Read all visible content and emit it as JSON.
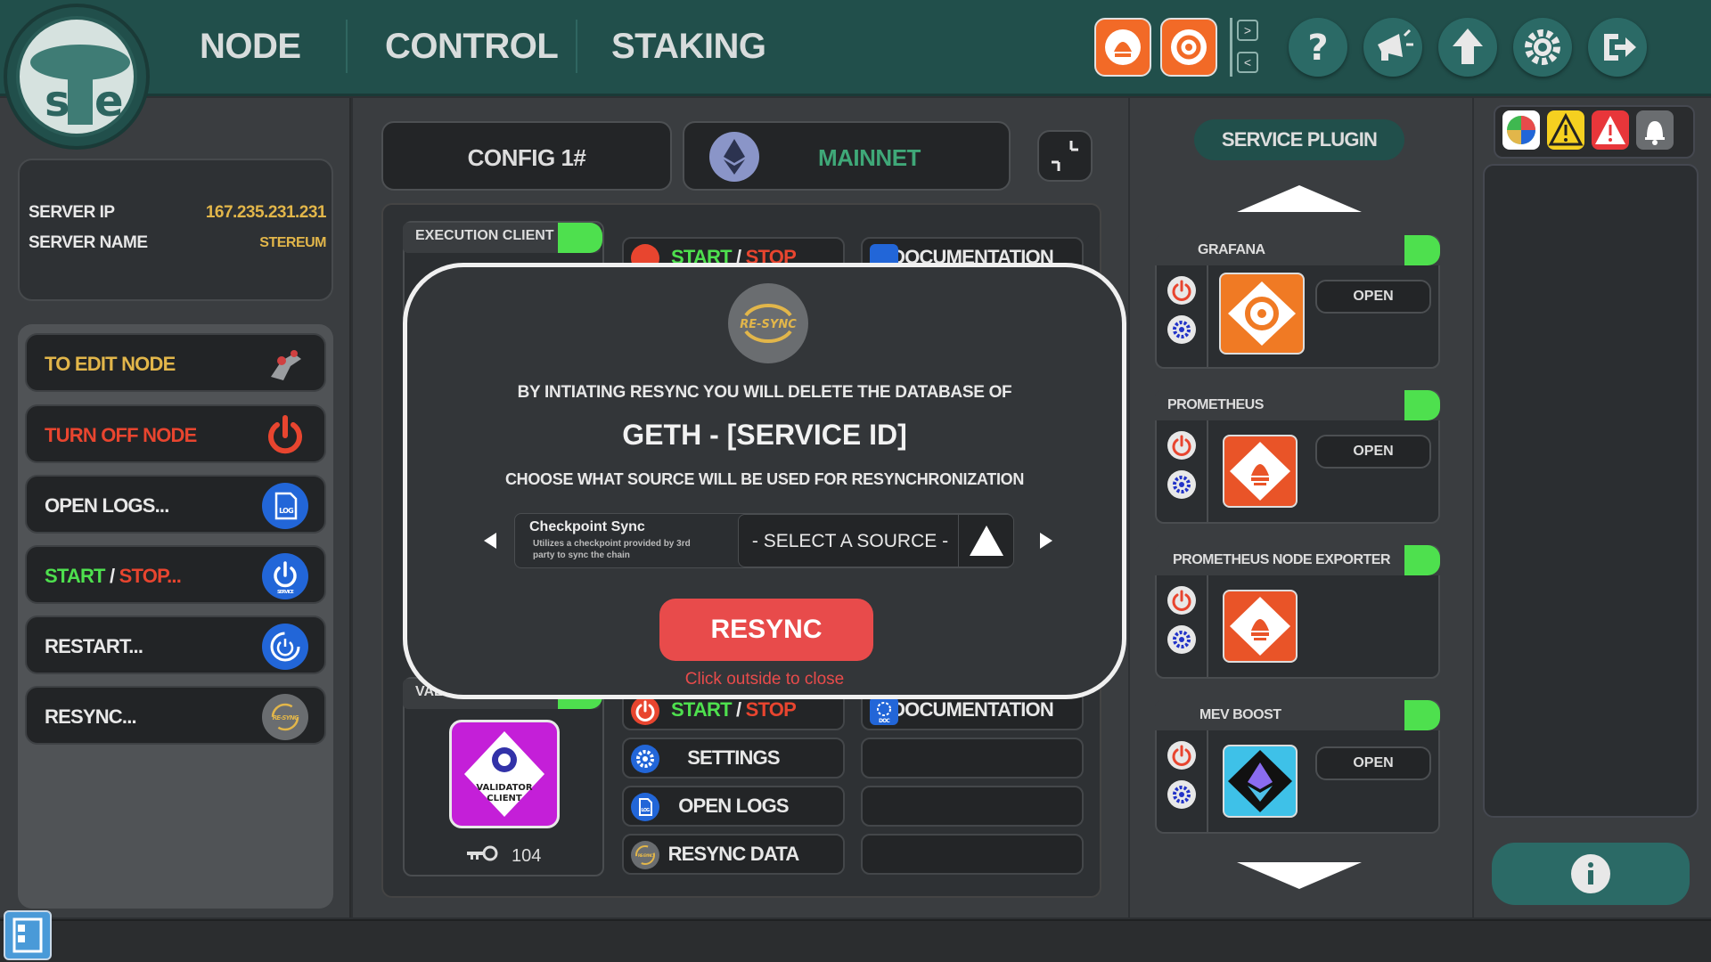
{
  "nav": {
    "items": [
      "NODE",
      "CONTROL",
      "STAKING"
    ],
    "icons": [
      "prometheus-icon",
      "grafana-icon",
      "help-icon",
      "announcement-icon",
      "update-icon",
      "settings-icon",
      "logout-icon"
    ]
  },
  "server": {
    "ip_label": "SERVER IP",
    "ip_value": "167.235.231.231",
    "name_label": "SERVER NAME",
    "name_value": "STEREUM"
  },
  "menu": {
    "edit_node": "TO EDIT NODE",
    "turn_off": "TURN OFF NODE",
    "open_logs": "OPEN LOGS...",
    "start": "START",
    "slash": " / ",
    "stop": "STOP...",
    "restart": "RESTART...",
    "resync": "RESYNC..."
  },
  "config": {
    "config_label": "CONFIG 1#",
    "network": "MAINNET"
  },
  "execution": {
    "title": "EXECUTION CLIENT",
    "start": "START",
    "slash": " / ",
    "stop": "STOP",
    "documentation": "DOCUMENTATION"
  },
  "validator": {
    "title": "VALIDATOR",
    "icon_line1": "VALIDATOR",
    "icon_line2": "CLIENT",
    "key_count": "104",
    "start": "START",
    "slash": " / ",
    "stop": "STOP",
    "documentation": "DOCUMENTATION",
    "settings": "SETTINGS",
    "open_logs": "OPEN LOGS",
    "resync_data": "RESYNC DATA",
    "log_badge": "LOG",
    "doc_badge": "DOC",
    "resync_badge": "RE-SYNC"
  },
  "plugins": {
    "title": "SERVICE PLUGIN",
    "items": [
      {
        "name": "GRAFANA",
        "open": "OPEN"
      },
      {
        "name": "PROMETHEUS",
        "open": "OPEN"
      },
      {
        "name": "PROMETHEUS NODE EXPORTER"
      },
      {
        "name": "MEV BOOST",
        "open": "OPEN"
      }
    ]
  },
  "modal": {
    "badge": "RE-SYNC",
    "warning": "BY INTIATING RESYNC YOU WILL DELETE THE DATABASE OF",
    "service": "GETH - [SERVICE ID]",
    "choose": "CHOOSE WHAT SOURCE WILL BE USED FOR RESYNCHRONIZATION",
    "option_title": "Checkpoint Sync",
    "option_desc": "Utilizes a checkpoint provided by 3rd party to sync the chain",
    "select": "- SELECT A SOURCE -",
    "resync_button": "RESYNC",
    "close_hint": "Click outside to close"
  },
  "menu_badges": {
    "log": "LOG",
    "service": "SERVICE",
    "resync": "RE-SYNC"
  },
  "colors": {
    "accent_green": "#4ee04e",
    "stop_red": "#e8452f",
    "resync_red": "#e84b4b",
    "gold": "#e2b64a",
    "teal": "#214f4b"
  }
}
